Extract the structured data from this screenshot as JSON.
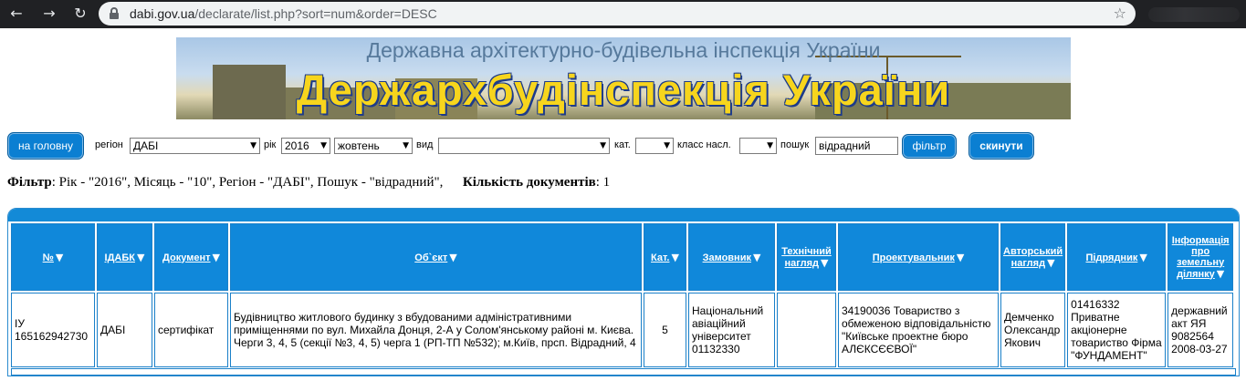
{
  "browser": {
    "url_host": "dabi.gov.ua",
    "url_path": "/declarate/list.php?sort=num&order=DESC",
    "back_icon": "arrow-left-icon",
    "forward_icon": "arrow-right-icon",
    "reload_icon": "reload-icon",
    "star_icon": "star-icon"
  },
  "banner": {
    "subtitle": "Державна архітектурно-будівельна інспекція України",
    "title": "Держархбудінспекція України"
  },
  "filter_bar": {
    "home_label": "на головну",
    "region_label": "регіон",
    "region_value": "ДАБІ",
    "year_label": "рік",
    "year_value": "2016",
    "month_value": "жовтень",
    "kind_label": "вид",
    "kind_value": "",
    "cat_label": "кат.",
    "cat_value": "",
    "class_label": "класс насл.",
    "class_value": "",
    "search_label": "пошук",
    "search_value": "відрадний",
    "filter_button": "фільтр",
    "reset_button": "скинути",
    "dropdown_icon": "▼"
  },
  "summary": {
    "filter_label": "Фільтр",
    "filter_text": ": Рік - \"2016\", Місяць - \"10\", Регіон - \"ДАБІ\", Пошук - \"відрадний\",",
    "count_label": "Кількість документів",
    "count_value": ": 1"
  },
  "table": {
    "headers": {
      "num": "№",
      "idabk": "ІДАБК",
      "doc": "Документ",
      "object": "Об`єкт",
      "cat": "Кат.",
      "customer": "Замовник",
      "tech_line1": "Технічний",
      "tech_line2": "нагляд",
      "designer": "Проектувальник",
      "author_line1": "Авторський",
      "author_line2": "нагляд",
      "contractor": "Підрядник",
      "land_line1": "Інформація",
      "land_line2": "про",
      "land_line3": "земельну",
      "land_line4": "ділянку",
      "sort_icon": "▼"
    },
    "row": {
      "num": "ІУ 165162942730",
      "idabk": "ДАБІ",
      "doc": "сертифікат",
      "object": "Будівництво житлового будинку з вбудованими адміністративними приміщеннями по вул. Михайла Донця, 2-А у Солом'янському районі м. Києва. Черги 3, 4, 5 (секції №3, 4, 5) черга 1 (РП-ТП №532); м.Київ, прсп. Відрадний, 4",
      "cat": "5",
      "customer": "Національний авіаційний університет 01132330",
      "tech": "",
      "designer": "34190036 Товариство з обмеженою відповідальністю \"Київське проектне бюро АЛЄКСЄЄВОЇ\"",
      "author": "Демченко Олександр Якович",
      "contractor": "01416332 Приватне акціонерне товариство Фірма \"ФУНДАМЕНТ\"",
      "land": "державний акт ЯЯ 9082564 2008-03-27"
    }
  }
}
